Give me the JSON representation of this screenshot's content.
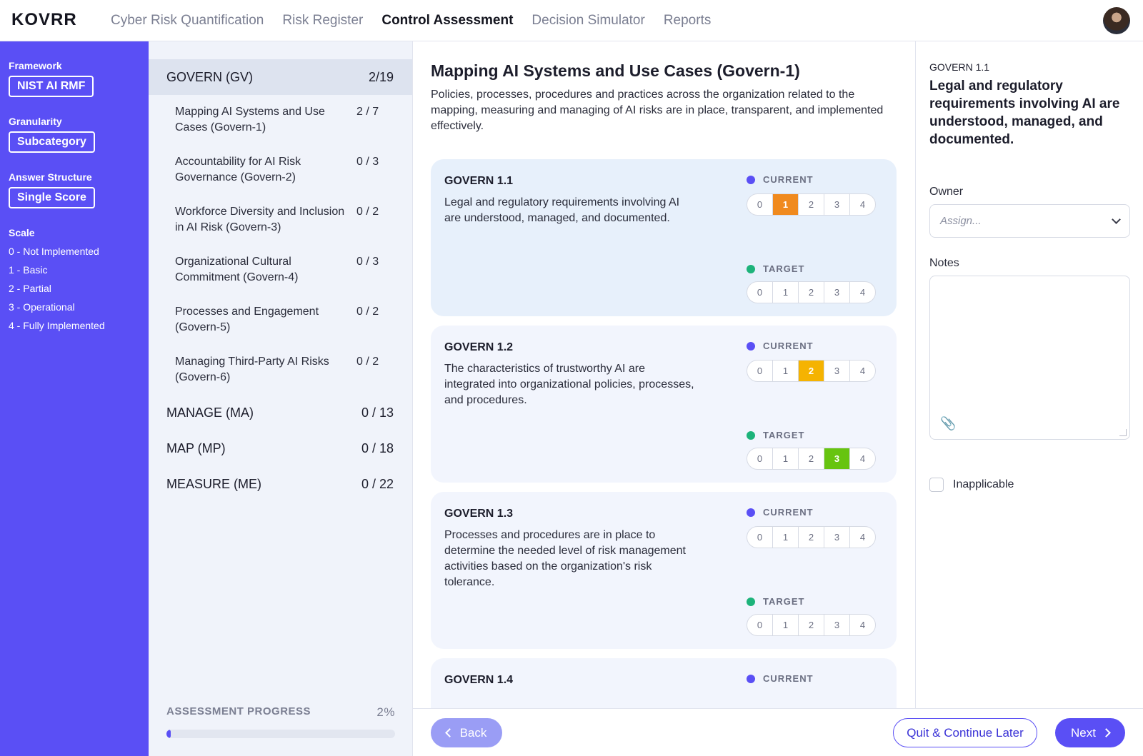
{
  "app": {
    "logo": "KOVRR",
    "nav": [
      "Cyber Risk Quantification",
      "Risk Register",
      "Control Assessment",
      "Decision Simulator",
      "Reports"
    ],
    "active_nav": "Control Assessment"
  },
  "sidebar": {
    "framework_label": "Framework",
    "framework_value": "NIST AI RMF",
    "granularity_label": "Granularity",
    "granularity_value": "Subcategory",
    "answer_label": "Answer Structure",
    "answer_value": "Single Score",
    "scale_label": "Scale",
    "scale": [
      "0 - Not Implemented",
      "1 - Basic",
      "2 - Partial",
      "3 - Operational",
      "4 - Fully Implemented"
    ]
  },
  "categories": {
    "govern": {
      "label": "GOVERN (GV)",
      "count": "2/19"
    },
    "subs": [
      {
        "label": "Mapping AI Systems and Use Cases (Govern-1)",
        "count": "2 / 7"
      },
      {
        "label": "Accountability for AI Risk Governance (Govern-2)",
        "count": "0 / 3"
      },
      {
        "label": "Workforce Diversity and Inclusion in AI Risk (Govern-3)",
        "count": "0 / 2"
      },
      {
        "label": "Organizational Cultural Commitment (Govern-4)",
        "count": "0 / 3"
      },
      {
        "label": "Processes and Engagement (Govern-5)",
        "count": "0 / 2"
      },
      {
        "label": "Managing Third-Party AI Risks (Govern-6)",
        "count": "0 / 2"
      }
    ],
    "others": [
      {
        "label": "MANAGE (MA)",
        "count": "0 / 13"
      },
      {
        "label": "MAP (MP)",
        "count": "0 / 18"
      },
      {
        "label": "MEASURE (ME)",
        "count": "0 / 22"
      }
    ],
    "progress_label": "ASSESSMENT PROGRESS",
    "progress_text": "2%",
    "progress_value": 0.02
  },
  "main": {
    "title": "Mapping AI Systems and Use Cases (Govern-1)",
    "description": "Policies, processes, procedures and practices across the organization related to the mapping, measuring and managing of AI risks are in place, transparent, and implemented effectively.",
    "current_label": "CURRENT",
    "target_label": "TARGET",
    "scale_options": [
      "0",
      "1",
      "2",
      "3",
      "4"
    ],
    "cards": [
      {
        "code": "GOVERN 1.1",
        "text": "Legal and regulatory requirements involving AI are understood, managed, and documented.",
        "current": 1,
        "target": null
      },
      {
        "code": "GOVERN 1.2",
        "text": "The characteristics of trustworthy AI are integrated into organizational policies, processes, and procedures.",
        "current": 2,
        "target": 3
      },
      {
        "code": "GOVERN 1.3",
        "text": "Processes and procedures are in place to determine the needed level of risk management activities based on the organization's risk tolerance.",
        "current": null,
        "target": null
      },
      {
        "code": "GOVERN 1.4",
        "text": "",
        "current": null,
        "target": null
      }
    ]
  },
  "details": {
    "code": "GOVERN 1.1",
    "title": "Legal and regulatory requirements involving AI are understood, managed, and documented.",
    "owner_label": "Owner",
    "owner_placeholder": "Assign...",
    "notes_label": "Notes",
    "inapplicable_label": "Inapplicable"
  },
  "footer": {
    "back": "Back",
    "quit": "Quit & Continue Later",
    "next": "Next"
  },
  "colors": {
    "accent": "#5a4ff5",
    "score_1": "#f08a1e",
    "score_2": "#f5b301",
    "score_3": "#67c410",
    "target_dot": "#1db37a"
  }
}
